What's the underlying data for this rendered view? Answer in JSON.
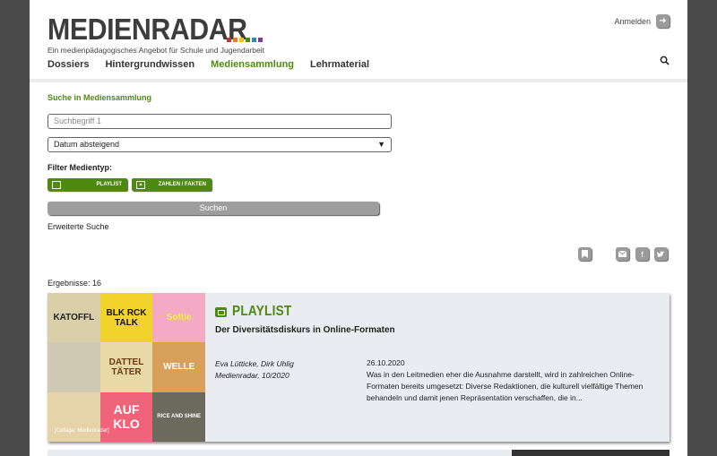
{
  "header": {
    "logo_text": "MEDIENRADAR",
    "logo_colors": [
      "#c0392b",
      "#e67e22",
      "#f1c40f",
      "#4f8a10",
      "#2e86c1",
      "#7d3c98"
    ],
    "tagline": "Ein medienpädagogisches Angebot für Schule und Jugendarbeit",
    "login_label": "Anmelden",
    "login_icon": "sign-in-icon",
    "search_icon": "search-icon"
  },
  "nav": {
    "items": [
      "Dossiers",
      "Hintergrundwissen",
      "Mediensammlung",
      "Lehrmaterial"
    ],
    "active": "Mediensammlung"
  },
  "search": {
    "title": "Suche in Mediensammlung",
    "placeholder": "Suchbegriff 1",
    "sort_value": "Datum absteigend",
    "filter_label": "Filter Medientyp:",
    "filters": [
      "PLAYLIST",
      "ZAHLEN / FAKTEN"
    ],
    "submit_label": "Suchen",
    "advanced_label": "Erweiterte Suche"
  },
  "actions": {
    "bookmark_icon": "bookmark-icon",
    "mail_icon": "mail-icon",
    "facebook_icon": "facebook-icon",
    "twitter_icon": "twitter-icon"
  },
  "results": {
    "count_label": "Ergebnisse: 16",
    "items": [
      {
        "type": "PLAYLIST",
        "title": "Der Diversitätsdiskurs in Online-Formaten",
        "author": "Eva Lütticke, Dirk Uhlig",
        "source": "Medienradar, 10/2020",
        "date": "26.10.2020",
        "teaser": "Was in den Leitmedien eher die Ausnahme darstellt, wird in zahlreichen Online-Formaten bereits umgesetzt: Diverse Redaktionen, die kulturell vielfältige Themen behandeln und damit jenen Repräsentation verschaffen, die in...",
        "credit": "[Collage: Medienradar]",
        "thumb_labels": [
          "KATOFFL",
          "BLK RCK TALK",
          "Softie",
          "",
          "DATTEL TÄTER",
          "WELLE",
          "",
          "AUF KLO",
          "RICE AND SHINE"
        ]
      }
    ]
  }
}
